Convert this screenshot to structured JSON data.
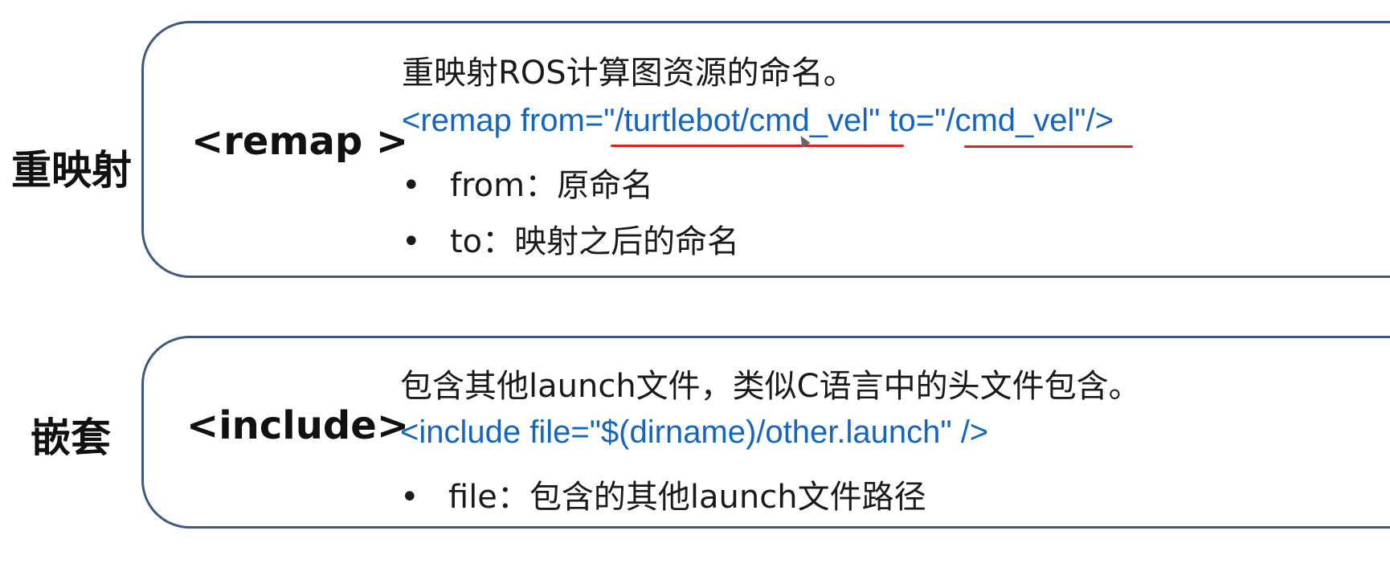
{
  "remap": {
    "section_label": "重映射",
    "tag": "<remap >",
    "description": "重映射ROS计算图资源的命名。",
    "code": "<remap from=\"/turtlebot/cmd_vel\" to=\"/cmd_vel\"/>",
    "bullets": [
      "from：原命名",
      "to：映射之后的命名"
    ]
  },
  "include": {
    "section_label": "嵌套",
    "tag": "<include>",
    "description": "包含其他launch文件，类似C语言中的头文件包含。",
    "code": "<include file=\"$(dirname)/other.launch\" />",
    "bullets": [
      "file：包含的其他launch文件路径"
    ]
  },
  "bullet_symbol": "•",
  "colors": {
    "border": "#3d5a80",
    "code": "#1565c0",
    "underline": "#e02020"
  }
}
